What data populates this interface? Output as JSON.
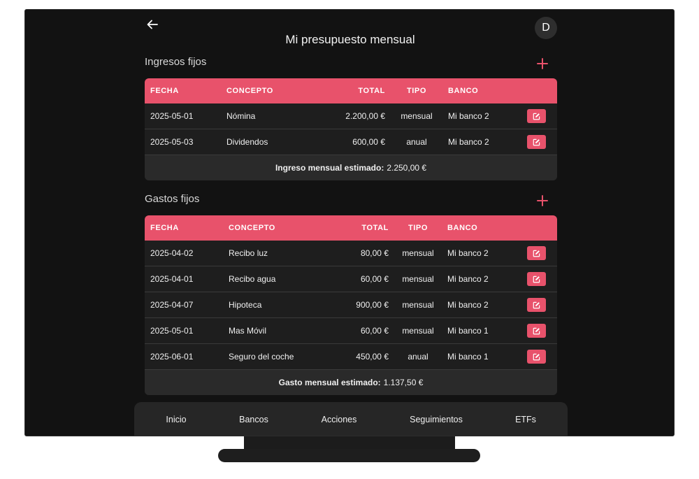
{
  "header": {
    "title": "Mi presupuesto mensual",
    "avatar_initial": "D"
  },
  "icons": {
    "back": "arrow-left-icon",
    "add": "plus-icon",
    "edit": "edit-icon"
  },
  "colors": {
    "accent": "#e8526b",
    "background": "#121212",
    "card": "#1e1e1e"
  },
  "ingresos": {
    "title": "Ingresos fijos",
    "columns": [
      "FECHA",
      "CONCEPTO",
      "TOTAL",
      "TIPO",
      "BANCO"
    ],
    "rows": [
      {
        "fecha": "2025-05-01",
        "concepto": "Nómina",
        "total": "2.200,00 €",
        "tipo": "mensual",
        "banco": "Mi banco 2"
      },
      {
        "fecha": "2025-05-03",
        "concepto": "Dividendos",
        "total": "600,00 €",
        "tipo": "anual",
        "banco": "Mi banco 2"
      }
    ],
    "summary_label": "Ingreso mensual estimado:",
    "summary_value": "2.250,00 €"
  },
  "gastos": {
    "title": "Gastos fijos",
    "columns": [
      "FECHA",
      "CONCEPTO",
      "TOTAL",
      "TIPO",
      "BANCO"
    ],
    "rows": [
      {
        "fecha": "2025-04-02",
        "concepto": "Recibo luz",
        "total": "80,00 €",
        "tipo": "mensual",
        "banco": "Mi banco 2"
      },
      {
        "fecha": "2025-04-01",
        "concepto": "Recibo agua",
        "total": "60,00 €",
        "tipo": "mensual",
        "banco": "Mi banco 2"
      },
      {
        "fecha": "2025-04-07",
        "concepto": "Hipoteca",
        "total": "900,00 €",
        "tipo": "mensual",
        "banco": "Mi banco 2"
      },
      {
        "fecha": "2025-05-01",
        "concepto": "Mas Móvil",
        "total": "60,00 €",
        "tipo": "mensual",
        "banco": "Mi banco 1"
      },
      {
        "fecha": "2025-06-01",
        "concepto": "Seguro del coche",
        "total": "450,00 €",
        "tipo": "anual",
        "banco": "Mi banco 1"
      }
    ],
    "summary_label": "Gasto mensual estimado:",
    "summary_value": "1.137,50 €"
  },
  "nav": [
    "Inicio",
    "Bancos",
    "Acciones",
    "Seguimientos",
    "ETFs"
  ]
}
